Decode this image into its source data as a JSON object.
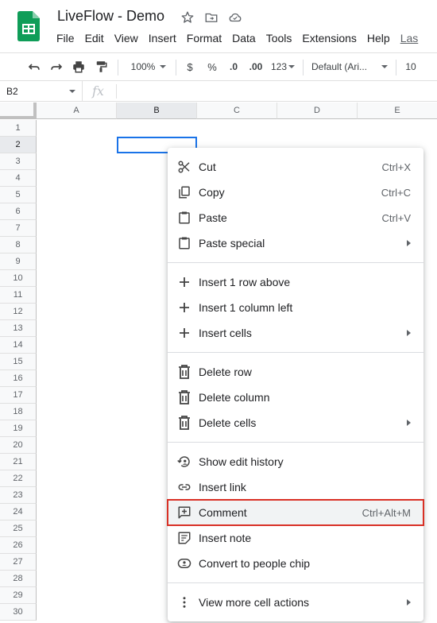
{
  "app": {
    "title": "LiveFlow - Demo",
    "menu": [
      "File",
      "Edit",
      "View",
      "Insert",
      "Format",
      "Data",
      "Tools",
      "Extensions",
      "Help"
    ],
    "last_edit": "Las"
  },
  "toolbar": {
    "zoom": "100%",
    "currency": "$",
    "percent": "%",
    "decrease_decimal": ".0",
    "increase_decimal": ".00",
    "more_formats": "123",
    "font": "Default (Ari...",
    "font_size": "10"
  },
  "formula_bar": {
    "cell_ref": "B2",
    "fx": "fx"
  },
  "columns": [
    "A",
    "B",
    "C",
    "D",
    "E"
  ],
  "rows": [
    "1",
    "2",
    "3",
    "4",
    "5",
    "6",
    "7",
    "8",
    "9",
    "10",
    "11",
    "12",
    "13",
    "14",
    "15",
    "16",
    "17",
    "18",
    "19",
    "20",
    "21",
    "22",
    "23",
    "24",
    "25",
    "26",
    "27",
    "28",
    "29",
    "30"
  ],
  "selected": {
    "column": "B",
    "row": "2"
  },
  "context_menu": {
    "items": [
      {
        "label": "Cut",
        "shortcut": "Ctrl+X",
        "icon": "scissors-icon"
      },
      {
        "label": "Copy",
        "shortcut": "Ctrl+C",
        "icon": "copy-icon"
      },
      {
        "label": "Paste",
        "shortcut": "Ctrl+V",
        "icon": "clipboard-icon"
      },
      {
        "label": "Paste special",
        "shortcut": "",
        "icon": "clipboard-icon",
        "submenu": true
      },
      {
        "label": "Insert 1 row above",
        "shortcut": "",
        "icon": "plus-icon"
      },
      {
        "label": "Insert 1 column left",
        "shortcut": "",
        "icon": "plus-icon"
      },
      {
        "label": "Insert cells",
        "shortcut": "",
        "icon": "plus-icon",
        "submenu": true
      },
      {
        "label": "Delete row",
        "shortcut": "",
        "icon": "trash-icon"
      },
      {
        "label": "Delete column",
        "shortcut": "",
        "icon": "trash-icon"
      },
      {
        "label": "Delete cells",
        "shortcut": "",
        "icon": "trash-icon",
        "submenu": true
      },
      {
        "label": "Show edit history",
        "shortcut": "",
        "icon": "history-icon"
      },
      {
        "label": "Insert link",
        "shortcut": "",
        "icon": "link-icon"
      },
      {
        "label": "Comment",
        "shortcut": "Ctrl+Alt+M",
        "icon": "add-comment-icon",
        "highlighted": true
      },
      {
        "label": "Insert note",
        "shortcut": "",
        "icon": "note-icon"
      },
      {
        "label": "Convert to people chip",
        "shortcut": "",
        "icon": "person-chip-icon"
      },
      {
        "label": "View more cell actions",
        "shortcut": "",
        "icon": "more-vert-icon",
        "submenu": true
      }
    ]
  },
  "colors": {
    "accent": "#1a73e8",
    "highlight_outline": "#d93025",
    "sheets_green": "#0f9d58"
  }
}
